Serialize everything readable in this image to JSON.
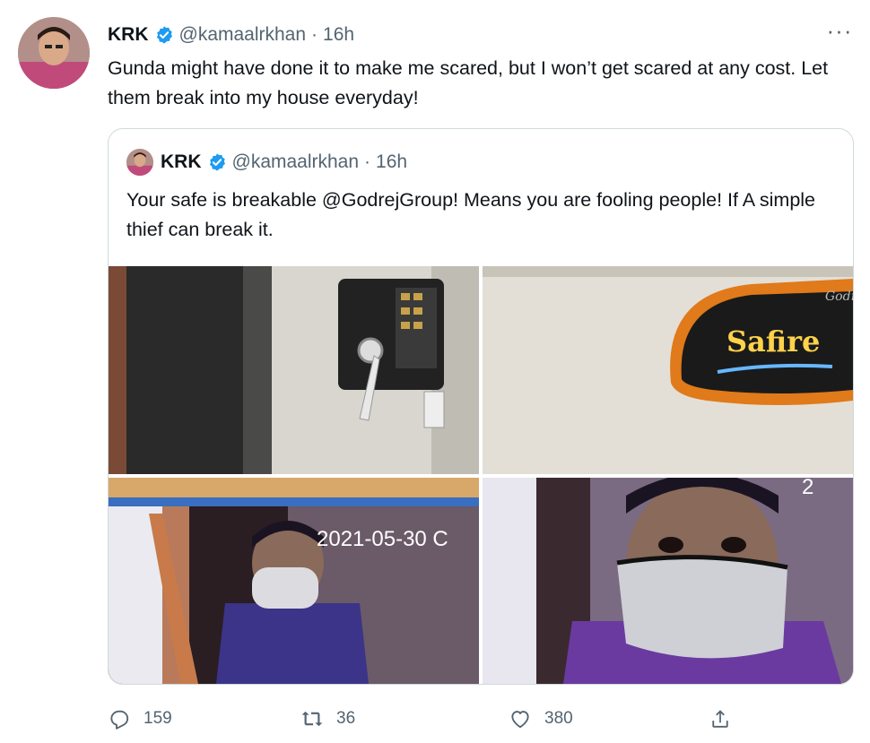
{
  "tweet": {
    "name": "KRK",
    "handle": "@kamaalrkhan",
    "separator": "·",
    "time": "16h",
    "more_label": "···",
    "text": "Gunda might have done it to make me scared, but I won’t get scared at any cost. Let them break into my house everyday!",
    "avatar_icon": "user-avatar",
    "verified_icon": "verified-badge-icon",
    "accent_color": "#1d9bf0"
  },
  "quote": {
    "name": "KRK",
    "handle": "@kamaalrkhan",
    "separator": "·",
    "time": "16h",
    "text": "Your safe is breakable @GodrejGroup! Means you are fooling people! If A simple thief can break it.",
    "media": {
      "cctv_timestamp": "2021-05-30 C",
      "cctv_timestamp_partial": "2",
      "logo_brand": "Godrej",
      "logo_text": "Safire"
    }
  },
  "actions": {
    "replies": "159",
    "retweets": "36",
    "likes": "380",
    "icons": [
      "reply-icon",
      "retweet-icon",
      "like-icon",
      "share-icon"
    ]
  }
}
